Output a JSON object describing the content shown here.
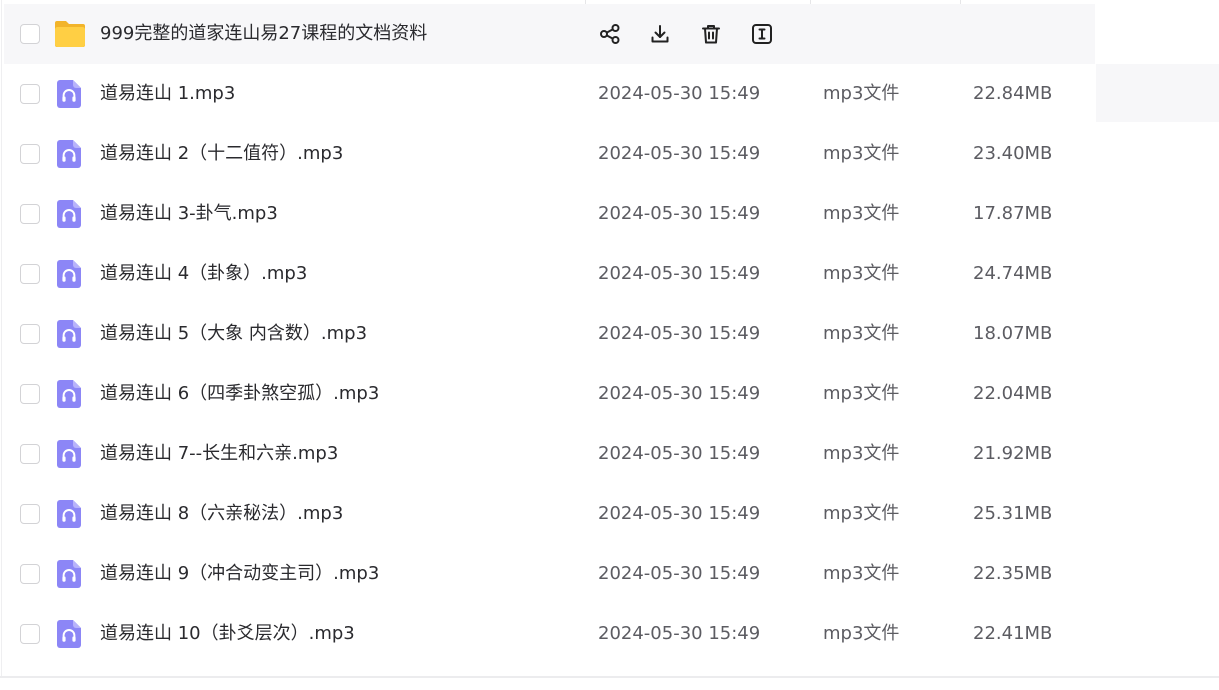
{
  "colors": {
    "hover_row_background": "#f7f7f9",
    "folder_icon": "#ffcf44",
    "audio_icon": "#8c86f6",
    "text_primary": "#2a2a2e",
    "text_secondary": "#5c5c62"
  },
  "icons": {
    "folder": "folder-icon",
    "file": "audio-file-icon",
    "share": "share-icon",
    "download": "download-icon",
    "delete": "trash-icon",
    "rename": "rename-icon"
  },
  "folder": {
    "name": "999完整的道家连山易27课程的文档资料"
  },
  "files": [
    {
      "name": "道易连山 1.mp3",
      "date": "2024-05-30 15:49",
      "type": "mp3文件",
      "size": "22.84MB"
    },
    {
      "name": "道易连山 2（十二值符）.mp3",
      "date": "2024-05-30 15:49",
      "type": "mp3文件",
      "size": "23.40MB"
    },
    {
      "name": "道易连山 3-卦气.mp3",
      "date": "2024-05-30 15:49",
      "type": "mp3文件",
      "size": "17.87MB"
    },
    {
      "name": "道易连山 4（卦象）.mp3",
      "date": "2024-05-30 15:49",
      "type": "mp3文件",
      "size": "24.74MB"
    },
    {
      "name": "道易连山 5（大象 内含数）.mp3",
      "date": "2024-05-30 15:49",
      "type": "mp3文件",
      "size": "18.07MB"
    },
    {
      "name": "道易连山 6（四季卦煞空孤）.mp3",
      "date": "2024-05-30 15:49",
      "type": "mp3文件",
      "size": "22.04MB"
    },
    {
      "name": "道易连山 7--长生和六亲.mp3",
      "date": "2024-05-30 15:49",
      "type": "mp3文件",
      "size": "21.92MB"
    },
    {
      "name": "道易连山 8（六亲秘法）.mp3",
      "date": "2024-05-30 15:49",
      "type": "mp3文件",
      "size": "25.31MB"
    },
    {
      "name": "道易连山 9（冲合动变主司）.mp3",
      "date": "2024-05-30 15:49",
      "type": "mp3文件",
      "size": "22.35MB"
    },
    {
      "name": "道易连山 10（卦爻层次）.mp3",
      "date": "2024-05-30 15:49",
      "type": "mp3文件",
      "size": "22.41MB"
    }
  ]
}
